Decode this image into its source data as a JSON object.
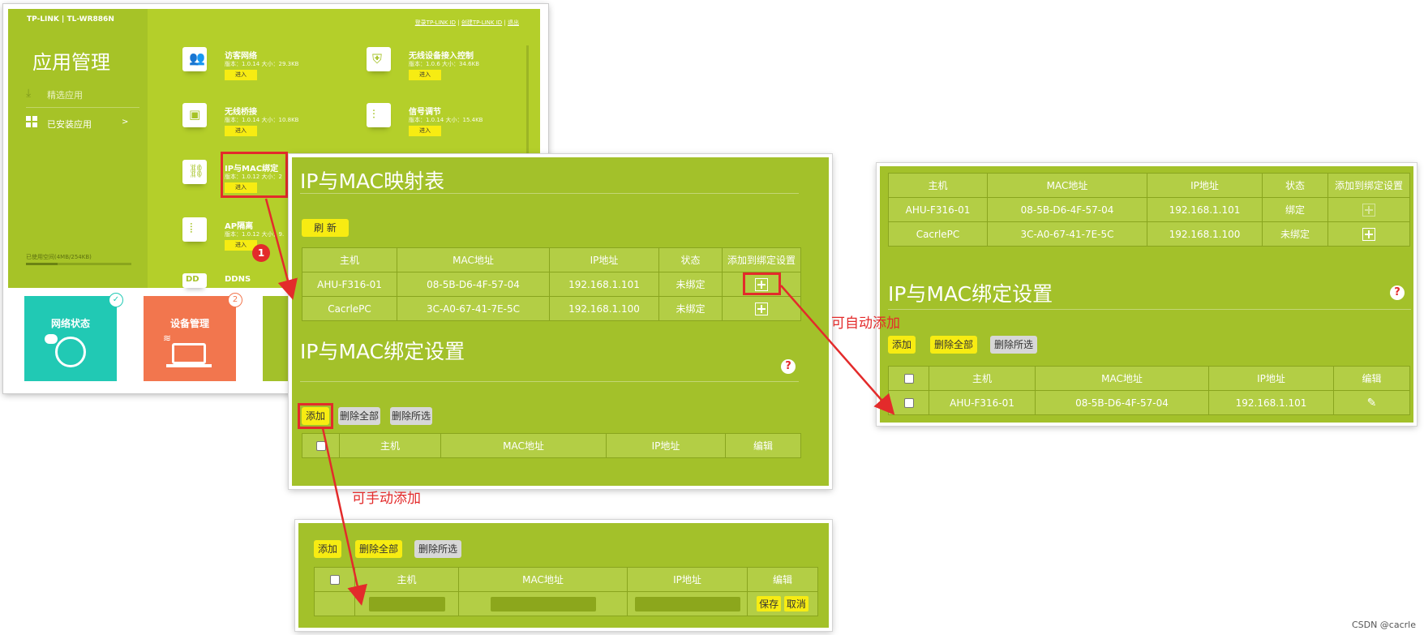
{
  "router": {
    "brand": "TP-LINK",
    "model": "TL-WR886N",
    "top_links": [
      "登录TP-LINK ID",
      "创建TP-LINK ID",
      "退出"
    ],
    "sidebar_title": "应用管理",
    "sidebar_items": [
      {
        "label": "精选应用"
      },
      {
        "label": "已安装应用"
      }
    ],
    "sidebar_chevron": ">",
    "storage_label": "已使用空间(4MB/254KB)",
    "apps": [
      {
        "name": "访客网络",
        "version": "版本：1.0.14 大小：29.3KB",
        "enter": "进入"
      },
      {
        "name": "无线设备接入控制",
        "version": "版本：1.0.6 大小：34.6KB",
        "enter": "进入"
      },
      {
        "name": "无线桥接",
        "version": "版本：1.0.14 大小：10.8KB",
        "enter": "进入"
      },
      {
        "name": "信号调节",
        "version": "版本：1.0.14 大小：15.4KB",
        "enter": "进入"
      },
      {
        "name": "IP与MAC绑定",
        "version": "版本：1.0.12 大小：2",
        "enter": "进入"
      },
      {
        "name": "AP隔离",
        "version": "版本：1.0.12 大小：9.",
        "enter": "进入"
      },
      {
        "name": "DDNS"
      }
    ],
    "tiles": [
      {
        "label": "网络状态",
        "color": "#21c9b4"
      },
      {
        "label": "设备管理",
        "color": "#f2764e",
        "badge": "2"
      }
    ],
    "step_badge": "1"
  },
  "mapping_panel": {
    "title": "IP与MAC映射表",
    "refresh": "刷 新",
    "headers": [
      "主机",
      "MAC地址",
      "IP地址",
      "状态",
      "添加到绑定设置"
    ],
    "rows": [
      {
        "host": "AHU-F316-01",
        "mac": "08-5B-D6-4F-57-04",
        "ip": "192.168.1.101",
        "status": "未绑定"
      },
      {
        "host": "CacrlePC",
        "mac": "3C-A0-67-41-7E-5C",
        "ip": "192.168.1.100",
        "status": "未绑定"
      }
    ],
    "bind_title": "IP与MAC绑定设置",
    "help": "?",
    "add": "添加",
    "delete_all": "删除全部",
    "delete_selected": "删除所选",
    "bind_headers": [
      "主机",
      "MAC地址",
      "IP地址",
      "编辑"
    ]
  },
  "right_panel": {
    "headers": [
      "主机",
      "MAC地址",
      "IP地址",
      "状态",
      "添加到绑定设置"
    ],
    "rows": [
      {
        "host": "AHU-F316-01",
        "mac": "08-5B-D6-4F-57-04",
        "ip": "192.168.1.101",
        "status": "绑定"
      },
      {
        "host": "CacrlePC",
        "mac": "3C-A0-67-41-7E-5C",
        "ip": "192.168.1.100",
        "status": "未绑定"
      }
    ],
    "bind_title": "IP与MAC绑定设置",
    "help": "?",
    "add": "添加",
    "delete_all": "删除全部",
    "delete_selected": "删除所选",
    "bind_headers": [
      "主机",
      "MAC地址",
      "IP地址",
      "编辑"
    ],
    "bind_row": {
      "host": "AHU-F316-01",
      "mac": "08-5B-D6-4F-57-04",
      "ip": "192.168.1.101"
    }
  },
  "manual_panel": {
    "add": "添加",
    "delete_all": "删除全部",
    "delete_selected": "删除所选",
    "headers": [
      "主机",
      "MAC地址",
      "IP地址",
      "编辑"
    ],
    "save": "保存",
    "cancel": "取消"
  },
  "annotations": {
    "auto_add": "可自动添加",
    "manual_add": "可手动添加"
  },
  "watermark": "CSDN @cacrle",
  "colors": {
    "panel_green": "#a3c12a",
    "router_green": "#b4cf2a",
    "sidebar_green": "#a6c327",
    "button_yellow": "#f7ec12",
    "annotation_red": "#e32b2b"
  }
}
